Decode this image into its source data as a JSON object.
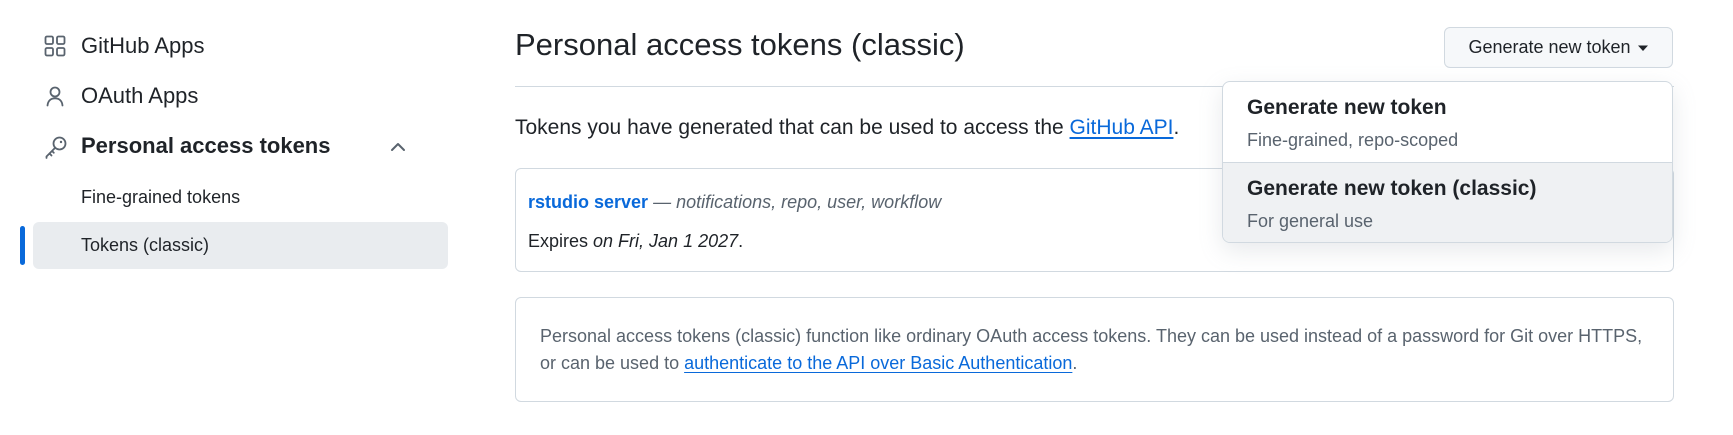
{
  "sidebar": {
    "items": [
      {
        "label": "GitHub Apps",
        "icon": "apps-grid-icon"
      },
      {
        "label": "OAuth Apps",
        "icon": "person-icon"
      },
      {
        "label": "Personal access tokens",
        "icon": "key-icon",
        "expanded": true,
        "children": [
          {
            "label": "Fine-grained tokens",
            "active": false
          },
          {
            "label": "Tokens (classic)",
            "active": true
          }
        ]
      }
    ]
  },
  "main": {
    "title": "Personal access tokens (classic)",
    "generate_button_label": "Generate new token",
    "intro_text": "Tokens you have generated that can be used to access the ",
    "intro_link": "GitHub API",
    "intro_suffix": ".",
    "token": {
      "name": "rstudio server",
      "separator": " — ",
      "scopes": "notifications, repo, user, workflow",
      "expires_prefix": "Expires ",
      "expires_date": "on Fri, Jan 1 2027",
      "expires_suffix": "."
    },
    "info": {
      "text": "Personal access tokens (classic) function like ordinary OAuth access tokens. They can be used instead of a password for Git over HTTPS, or can be used to ",
      "link": "authenticate to the API over Basic Authentication",
      "suffix": "."
    }
  },
  "dropdown": {
    "items": [
      {
        "title": "Generate new token",
        "description": "Fine-grained, repo-scoped",
        "highlighted": false
      },
      {
        "title": "Generate new token (classic)",
        "description": "For general use",
        "highlighted": true
      }
    ]
  },
  "colors": {
    "accent": "#0969da",
    "border": "#d1d9e0",
    "muted_text": "#59636e",
    "active_bg": "#e9ecef"
  }
}
